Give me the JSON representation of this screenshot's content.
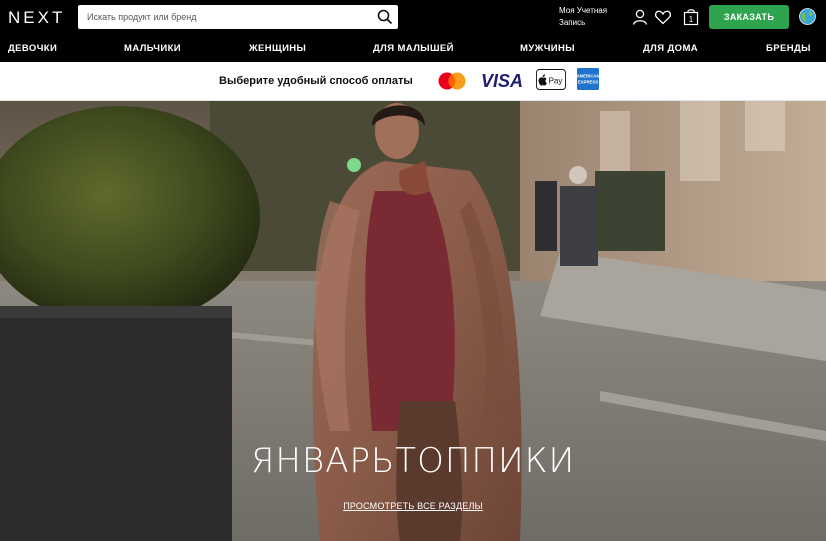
{
  "header": {
    "logo": "NEXT",
    "search_placeholder": "Искать продукт или бренд",
    "account_line1": "Моя Учетная",
    "account_line2": "Запись",
    "cart_count": "1",
    "order_label": "ЗАКАЗАТЬ"
  },
  "nav": {
    "items": [
      "ДЕВОЧКИ",
      "МАЛЬЧИКИ",
      "ЖЕНЩИНЫ",
      "ДЛЯ МАЛЫШЕЙ",
      "МУЖЧИНЫ",
      "ДЛЯ ДОМА",
      "БРЕНДЫ"
    ]
  },
  "payment": {
    "text": "Выберите удобный способ оплаты",
    "visa": "VISA",
    "applepay": "Pay",
    "amex": "AMERICAN EXPRESS"
  },
  "hero": {
    "title": "ЯНВАРЬТОППИКИ",
    "link": "ПРОСМОТРЕТЬ ВСЕ РАЗДЕЛЫ"
  },
  "colors": {
    "header_bg": "#000000",
    "order_button": "#2ea44f"
  }
}
